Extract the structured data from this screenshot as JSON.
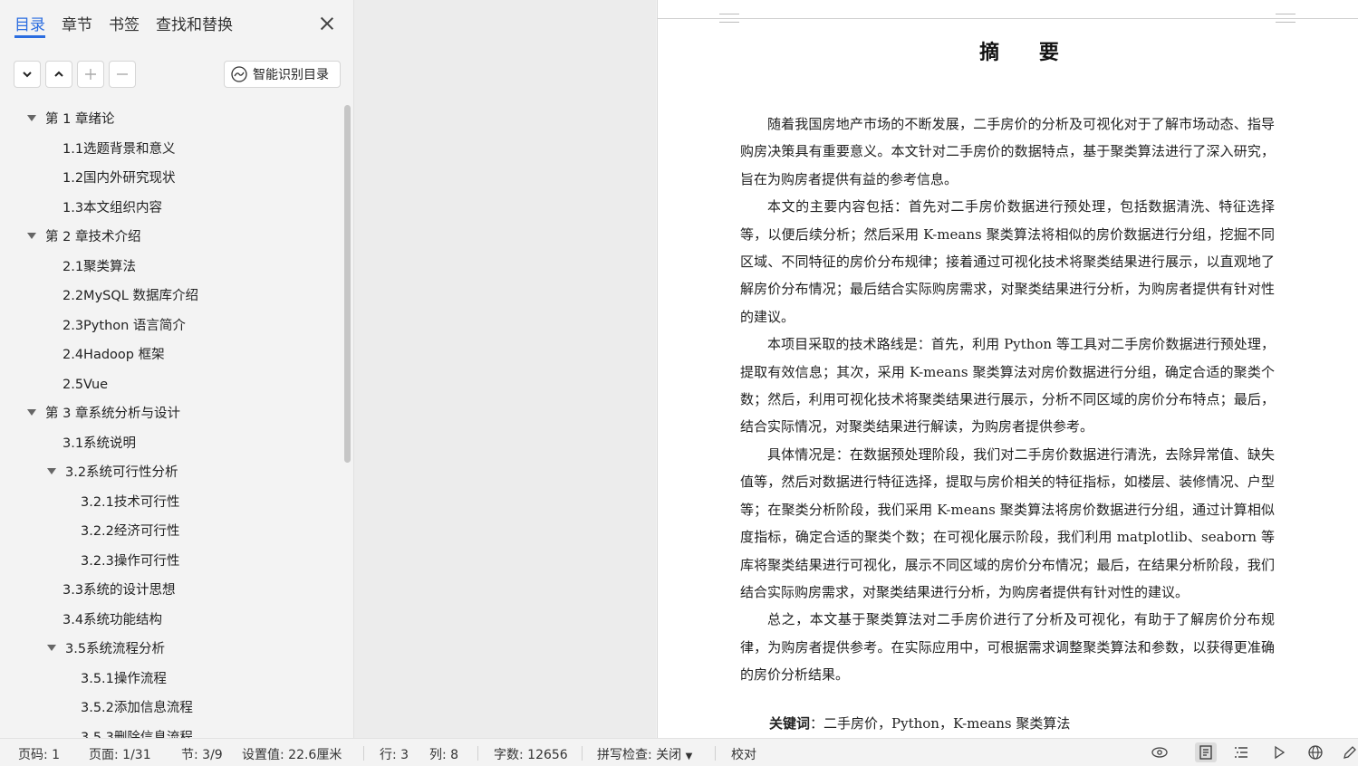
{
  "nav": {
    "tabs": [
      "目录",
      "章节",
      "书签",
      "查找和替换"
    ],
    "active_tab": "目录",
    "smart_button_label": "智能识别目录",
    "toc": [
      {
        "label": "第 1 章绪论",
        "level": 0,
        "expanded": true
      },
      {
        "label": "1.1选题背景和意义",
        "level": 1
      },
      {
        "label": "1.2国内外研究现状",
        "level": 1
      },
      {
        "label": "1.3本文组织内容",
        "level": 1
      },
      {
        "label": "第 2 章技术介绍",
        "level": 0,
        "expanded": true
      },
      {
        "label": "2.1聚类算法",
        "level": 1
      },
      {
        "label": "2.2MySQL 数据库介绍",
        "level": 1
      },
      {
        "label": "2.3Python 语言简介",
        "level": 1
      },
      {
        "label": "2.4Hadoop 框架",
        "level": 1
      },
      {
        "label": "2.5Vue",
        "level": 1
      },
      {
        "label": "第 3 章系统分析与设计",
        "level": 0,
        "expanded": true
      },
      {
        "label": "3.1系统说明",
        "level": 1
      },
      {
        "label": "3.2系统可行性分析",
        "level": 1,
        "expanded": true
      },
      {
        "label": "3.2.1技术可行性",
        "level": 2
      },
      {
        "label": "3.2.2经济可行性",
        "level": 2
      },
      {
        "label": "3.2.3操作可行性",
        "level": 2
      },
      {
        "label": "3.3系统的设计思想",
        "level": 1
      },
      {
        "label": "3.4系统功能结构",
        "level": 1
      },
      {
        "label": "3.5系统流程分析",
        "level": 1,
        "expanded": true
      },
      {
        "label": "3.5.1操作流程",
        "level": 2
      },
      {
        "label": "3.5.2添加信息流程",
        "level": 2
      },
      {
        "label": "3.5.3删除信息流程",
        "level": 2
      }
    ]
  },
  "document": {
    "title": "摘 要",
    "paragraphs": [
      "随着我国房地产市场的不断发展，二手房价的分析及可视化对于了解市场动态、指导购房决策具有重要意义。本文针对二手房价的数据特点，基于聚类算法进行了深入研究，旨在为购房者提供有益的参考信息。",
      "本文的主要内容包括：首先对二手房价数据进行预处理，包括数据清洗、特征选择等，以便后续分析；然后采用 K-means 聚类算法将相似的房价数据进行分组，挖掘不同区域、不同特征的房价分布规律；接着通过可视化技术将聚类结果进行展示，以直观地了解房价分布情况；最后结合实际购房需求，对聚类结果进行分析，为购房者提供有针对性的建议。",
      "本项目采取的技术路线是：首先，利用 Python 等工具对二手房价数据进行预处理，提取有效信息；其次，采用 K-means 聚类算法对房价数据进行分组，确定合适的聚类个数；然后，利用可视化技术将聚类结果进行展示，分析不同区域的房价分布特点；最后，结合实际情况，对聚类结果进行解读，为购房者提供参考。",
      "具体情况是：在数据预处理阶段，我们对二手房价数据进行清洗，去除异常值、缺失值等，然后对数据进行特征选择，提取与房价相关的特征指标，如楼层、装修情况、户型等；在聚类分析阶段，我们采用 K-means 聚类算法将房价数据进行分组，通过计算相似度指标，确定合适的聚类个数；在可视化展示阶段，我们利用 matplotlib、seaborn 等库将聚类结果进行可视化，展示不同区域的房价分布情况；最后，在结果分析阶段，我们结合实际购房需求，对聚类结果进行分析，为购房者提供有针对性的建议。",
      "总之，本文基于聚类算法对二手房价进行了分析及可视化，有助于了解房价分布规律，为购房者提供参考。在实际应用中，可根据需求调整聚类算法和参数，以获得更准确的房价分析结果。"
    ],
    "keywords_label": "关键词",
    "keywords_text": "：二手房价，Python，K-means 聚类算法"
  },
  "status": {
    "page_code": "页码: 1",
    "page": "页面: 1/31",
    "section": "节: 3/9",
    "setting": "设置值: 22.6厘米",
    "row": "行: 3",
    "col": "列: 8",
    "word_count": "字数: 12656",
    "spell_check": "拼写检查: 关闭",
    "proofread": "校对"
  }
}
